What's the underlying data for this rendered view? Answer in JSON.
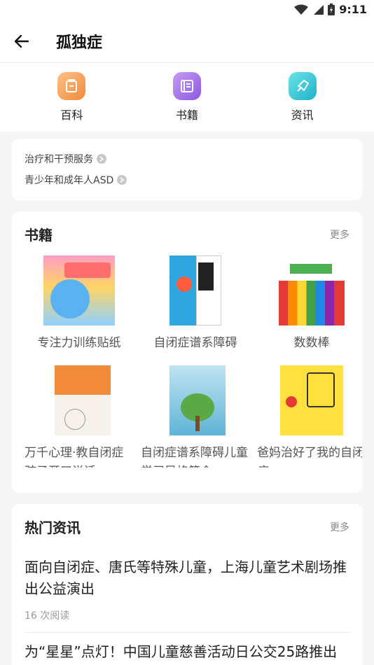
{
  "status": {
    "time": "9:11"
  },
  "header": {
    "title": "孤独症"
  },
  "categories": [
    {
      "label": "百科",
      "icon": "encyclopedia-icon",
      "color": "#f5a35a"
    },
    {
      "label": "书籍",
      "icon": "book-icon",
      "color": "#a974e8"
    },
    {
      "label": "资讯",
      "icon": "news-icon",
      "color": "#3ccbd6"
    }
  ],
  "tags": [
    {
      "label": "治疗和干预服务"
    },
    {
      "label": "青少年和成年人ASD"
    }
  ],
  "books": {
    "title": "书籍",
    "more": "更多",
    "items": [
      {
        "name": "专注力训练贴纸"
      },
      {
        "name": "自闭症谱系障碍"
      },
      {
        "name": "数数棒"
      },
      {
        "name": "万千心理·教自闭症孩子开口说话"
      },
      {
        "name": "自闭症谱系障碍儿童学习风格简介"
      },
      {
        "name": "爸妈治好了我的自闭症"
      }
    ]
  },
  "news": {
    "title": "热门资讯",
    "more": "更多",
    "items": [
      {
        "title": "面向自闭症、唐氏等特殊儿童，上海儿童艺术剧场推出公益演出",
        "reads": "16 次阅读"
      },
      {
        "title": "为“星星”点灯！中国儿童慈善活动日公交25路推出"
      }
    ]
  }
}
